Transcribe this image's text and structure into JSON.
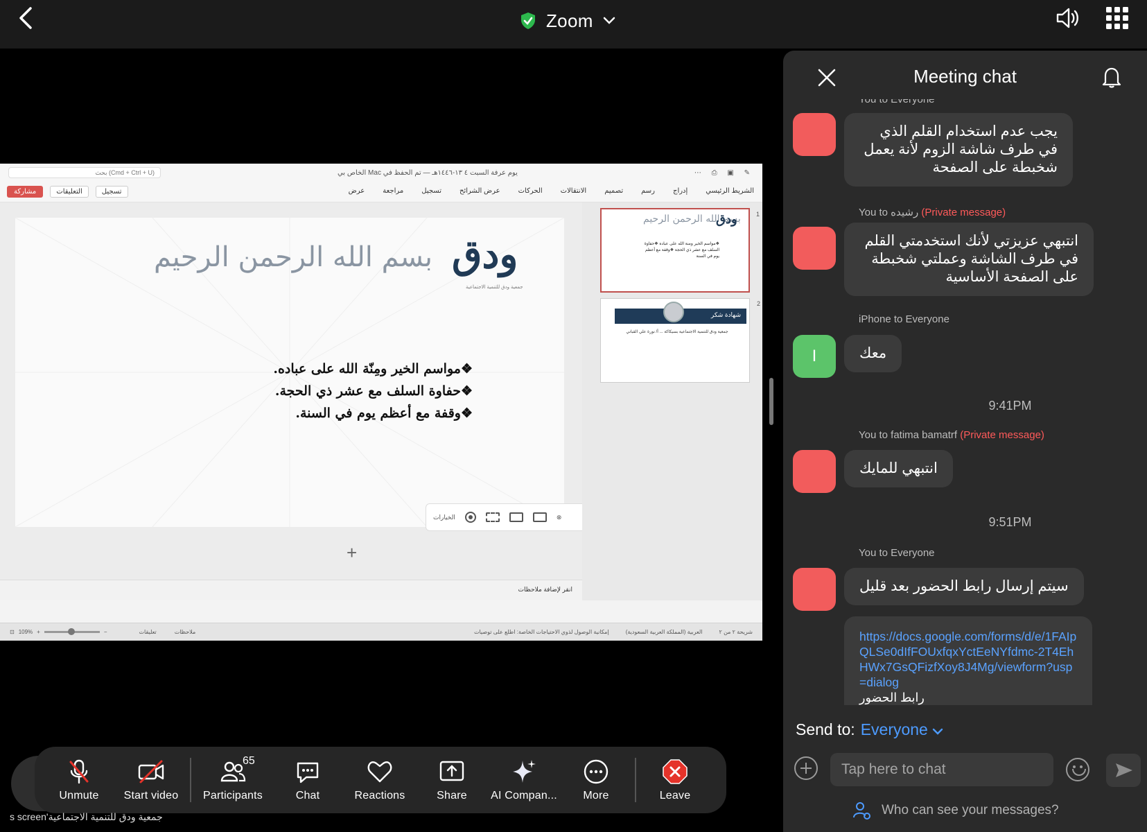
{
  "top_bar": {
    "title": "Zoom",
    "icons": {
      "back": "chevron-left-icon",
      "secure": "shield-check-icon",
      "dropdown": "chevron-down-icon",
      "speaker": "speaker-icon",
      "apps": "grid-icon"
    },
    "colors": {
      "secure": "#2db84d"
    }
  },
  "share": {
    "doc_title": "يوم عرفة السبت ٤ ١٣-١٤٤٦هـ — تم الحفظ في Mac الخاص بي",
    "search_placeholder": "بحث (Cmd + Ctrl + U)",
    "ribbon_tabs": [
      "الشريط الرئيسي",
      "إدراج",
      "رسم",
      "تصميم",
      "الانتقالات",
      "الحركات",
      "عرض الشرائح",
      "تسجيل",
      "مراجعة",
      "عرض"
    ],
    "share_label": "مشاركة",
    "comments_label": "التعليقات",
    "record_label": "تسجيل",
    "slide": {
      "basmala": "بسم الله الرحمن الرحيم",
      "logo": "ودق",
      "logo_sub": "جمعية ودق للتنمية الاجتماعية",
      "bullets": [
        "❖مواسم الخير ومِنّة الله على عباده.",
        "❖حفاوة السلف مع عشر ذي الحجة.",
        "❖وقفة مع أعظم يوم في السنة."
      ]
    },
    "view_options_label": "الخيارات",
    "add_slide": "+",
    "notes_placeholder": "انقر لإضافة ملاحظات",
    "thumb1": {
      "num": "1",
      "text": "❖مواسم الخير ومنة الله على عباده ❖حفاوة السلف مع عشر ذي الحجة ❖وقفة مع أعظم يوم في السنة"
    },
    "thumb2": {
      "num": "2",
      "header": "شهادة شكر",
      "body": "جمعية ودق للتنمية الاجتماعية بسيكاكة ... أ/ نورة علي القباني"
    },
    "status": {
      "slide_of": "شريحة ٢ من ٢",
      "language": "العربية (المملكة العربية السعودية)",
      "accessibility": "إمكانية الوصول لذوي الاحتياجات الخاصة: اطلع على توصيات",
      "notes": "ملاحظات",
      "comments": "تعليقات",
      "zoom": "109%"
    }
  },
  "toolbar": {
    "unmute": "Unmute",
    "start_video": "Start video",
    "participants": "Participants",
    "participants_count": "65",
    "chat": "Chat",
    "reactions": "Reactions",
    "share": "Share",
    "ai": "AI Compan...",
    "more": "More",
    "leave": "Leave",
    "colors": {
      "leave": "#e5332a",
      "muted": "#e5332a"
    }
  },
  "caption": "s screen'جمعية ودق للتنمية الاجتماعية",
  "chat": {
    "title": "Meeting chat",
    "partial_header": "You to Everyone",
    "messages": [
      {
        "sender": "",
        "text": "يجب عدم استخدام القلم الذي في طرف شاشة الزوم لأنة يعمل شخبطة على الصفحة",
        "avatar": ""
      },
      {
        "sender": "You to رشيده",
        "private": "(Private message)",
        "text": "انتبهي عزيزتي لأنك استخدمتي القلم في طرف الشاشة وعملتي شخبطة على الصفحة الأساسية",
        "avatar": ""
      },
      {
        "sender": "iPhone to Everyone",
        "text": "معك",
        "avatar": "I"
      },
      {
        "sender": "You to fatima bamatrf",
        "private": "(Private message)",
        "text": "انتبهي للمايك",
        "avatar": ""
      },
      {
        "sender": "You to Everyone",
        "text": "سيتم إرسال رابط الحضور بعد قليل",
        "avatar": ""
      }
    ],
    "times": [
      "9:41PM",
      "9:51PM"
    ],
    "link": {
      "url": "https://docs.google.com/forms/d/e/1FAIpQLSe0dIfFOUxfqxYctEeNYfdmc-2T4EhHWx7GsQFizfXoy8J4Mg/viewform?usp=dialog",
      "caption": "رابط الحضور"
    },
    "send_to_label": "Send to:",
    "send_to_value": "Everyone",
    "input_placeholder": "Tap here to chat",
    "who_can_see": "Who can see your messages?",
    "colors": {
      "avatar_you": "#f25c5c",
      "avatar_iphone": "#5cc46a",
      "link": "#5aa2ff",
      "private": "#ff5a5a"
    }
  }
}
